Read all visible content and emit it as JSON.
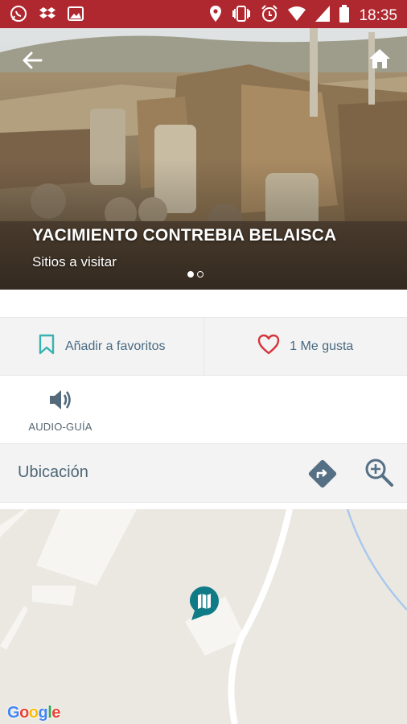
{
  "status_bar": {
    "time": "18:35",
    "icons_left": [
      "whatsapp-icon",
      "dropbox-icon",
      "image-icon"
    ],
    "icons_right": [
      "location-icon",
      "vibrate-icon",
      "alarm-icon",
      "wifi-icon",
      "signal-icon",
      "battery-icon"
    ],
    "color": "#b0282f"
  },
  "hero": {
    "title": "YACIMIENTO CONTREBIA BELAISCA",
    "subtitle": "Sitios a visitar",
    "slides": [
      true,
      false
    ]
  },
  "actions": {
    "favorites_label": "Añadir a favoritos",
    "likes_label": "1 Me gusta",
    "accent": "#486a82",
    "heart_color": "#d6343c",
    "bookmark_color": "#38b2b2"
  },
  "audio_guide": {
    "label": "AUDIO-GUÍA"
  },
  "location": {
    "title": "Ubicación"
  },
  "map": {
    "brand": "Google",
    "marker_color": "#0f7b86"
  }
}
